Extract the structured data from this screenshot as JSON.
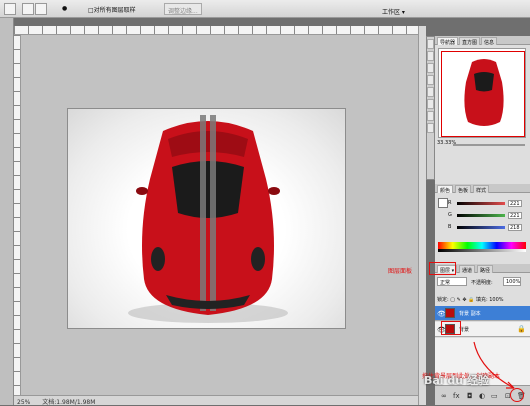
{
  "options_bar": {
    "opacity_label": "●",
    "antialias_label": "□对所有图层取样",
    "refine_edge": "调整边缘...",
    "workspace": "工作区 ▾"
  },
  "status": {
    "zoom": "25%",
    "doc": "文档:1.98M/1.98M"
  },
  "panels": {
    "navigator_tabs": [
      "导航器",
      "直方图",
      "信息"
    ],
    "zoom_value": "33.33%",
    "color_tabs": [
      "颜色",
      "色板",
      "样式"
    ],
    "rgb": [
      {
        "label": "R",
        "value": "221",
        "color": "#e34c4c"
      },
      {
        "label": "G",
        "value": "221",
        "color": "#4cb44c"
      },
      {
        "label": "B",
        "value": "218",
        "color": "#4c6ce3"
      }
    ],
    "layers_tabs": [
      "图层 ▾",
      "通道",
      "路径"
    ],
    "blend_mode": "正常",
    "opacity_label": "不透明度:",
    "opacity_value": "100%",
    "lock_label": "锁定:",
    "fill_label": "填充:",
    "fill_value": "100%",
    "layers": [
      {
        "name": "背景 副本",
        "selected": true
      },
      {
        "name": "背景",
        "selected": false
      }
    ]
  },
  "annotations": {
    "layers_panel": "图层面板",
    "drag_hint": "拖住背景层到此处，创建副本"
  },
  "watermark": "Bai du 经验",
  "colors": {
    "accent": "#e21010",
    "selected_layer": "#3d7fd6"
  }
}
